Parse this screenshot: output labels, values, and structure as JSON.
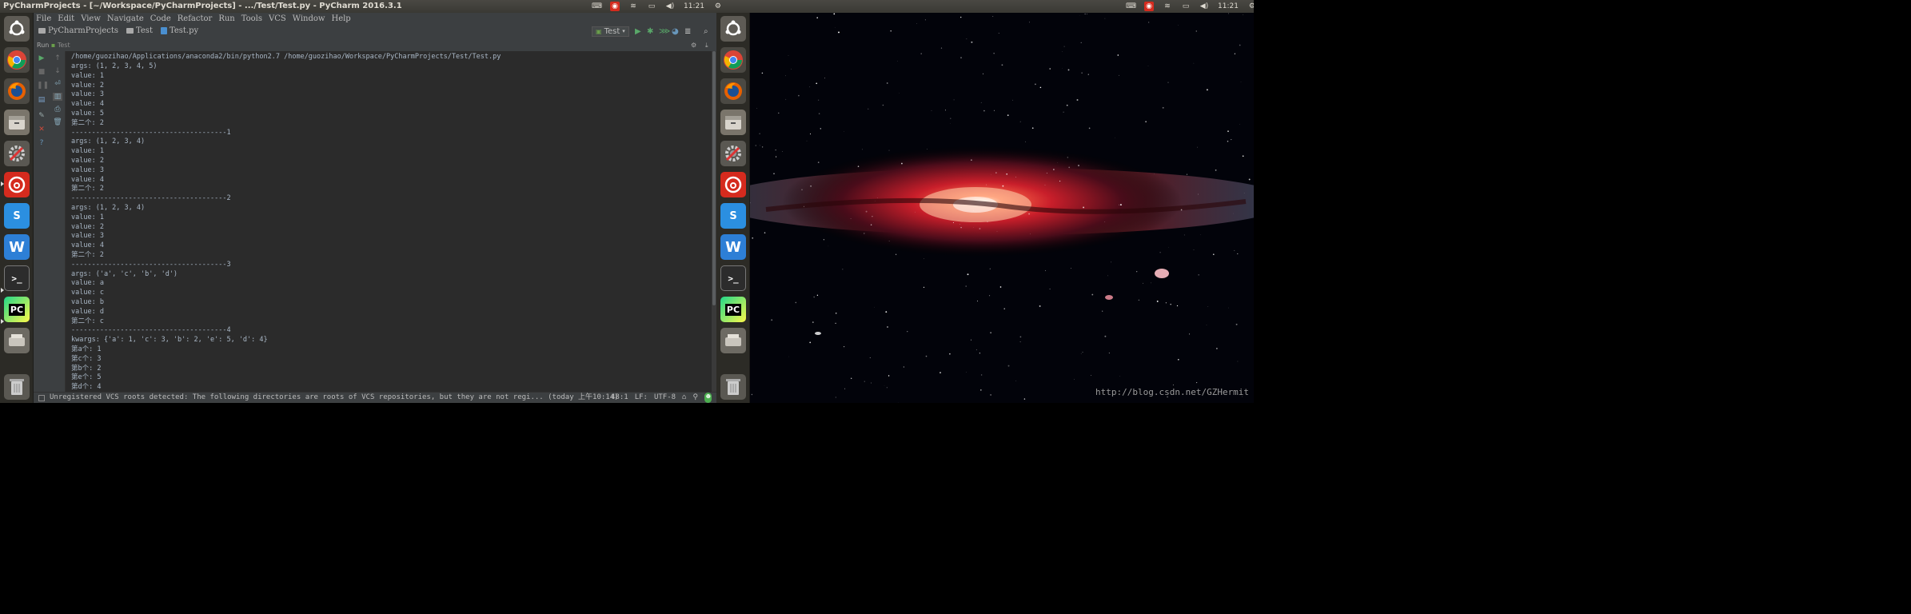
{
  "window_title": "PyCharmProjects - [~/Workspace/PyCharmProjects] - .../Test/Test.py - PyCharm 2016.3.1",
  "clock": "11:21",
  "menu": [
    "File",
    "Edit",
    "View",
    "Navigate",
    "Code",
    "Refactor",
    "Run",
    "Tools",
    "VCS",
    "Window",
    "Help"
  ],
  "breadcrumbs": [
    "PyCharmProjects",
    "Test",
    "Test.py"
  ],
  "run_config": "Test",
  "run_panel": {
    "tab_label": "Run",
    "config_label": "Test"
  },
  "console": {
    "command": "/home/guozihao/Applications/anaconda2/bin/python2.7 /home/guozihao/Workspace/PyCharmProjects/Test/Test.py",
    "lines": [
      "args: (1, 2, 3, 4, 5)",
      "value: 1",
      "value: 2",
      "value: 3",
      "value: 4",
      "value: 5",
      "第二个: 2",
      "--------------------------------------1",
      "args: (1, 2, 3, 4)",
      "value: 1",
      "value: 2",
      "value: 3",
      "value: 4",
      "第二个: 2",
      "--------------------------------------2",
      "args: (1, 2, 3, 4)",
      "value: 1",
      "value: 2",
      "value: 3",
      "value: 4",
      "第二个: 2",
      "--------------------------------------3",
      "args: ('a', 'c', 'b', 'd')",
      "value: a",
      "value: c",
      "value: b",
      "value: d",
      "第二个: c",
      "--------------------------------------4",
      "kwargs: {'a': 1, 'c': 3, 'b': 2, 'e': 5, 'd': 4}",
      "第a个: 1",
      "第c个: 3",
      "第b个: 2",
      "第e个: 5",
      "第d个: 4"
    ]
  },
  "status": {
    "message": "Unregistered VCS roots detected: The following directories are roots of VCS repositories, but they are not regi... (today 上午10:14)",
    "position": "48:1",
    "line_sep": "LF:",
    "encoding": "UTF-8"
  },
  "launcher_icons": [
    "ubuntu-dash-icon",
    "chrome-icon",
    "firefox-icon",
    "files-icon",
    "system-settings-icon",
    "netease-music-icon",
    "sogou-pinyin-icon",
    "wps-writer-icon",
    "terminal-icon",
    "pycharm-icon",
    "drive-icon",
    "trash-icon"
  ],
  "watermark": "http://blog.csdn.net/GZHermit",
  "colors": {
    "ide_bg": "#2b2b2b",
    "panel_bg": "#3c3f41",
    "console_text": "#a9b7c6",
    "ubuntu_bar": "#3a3934"
  }
}
